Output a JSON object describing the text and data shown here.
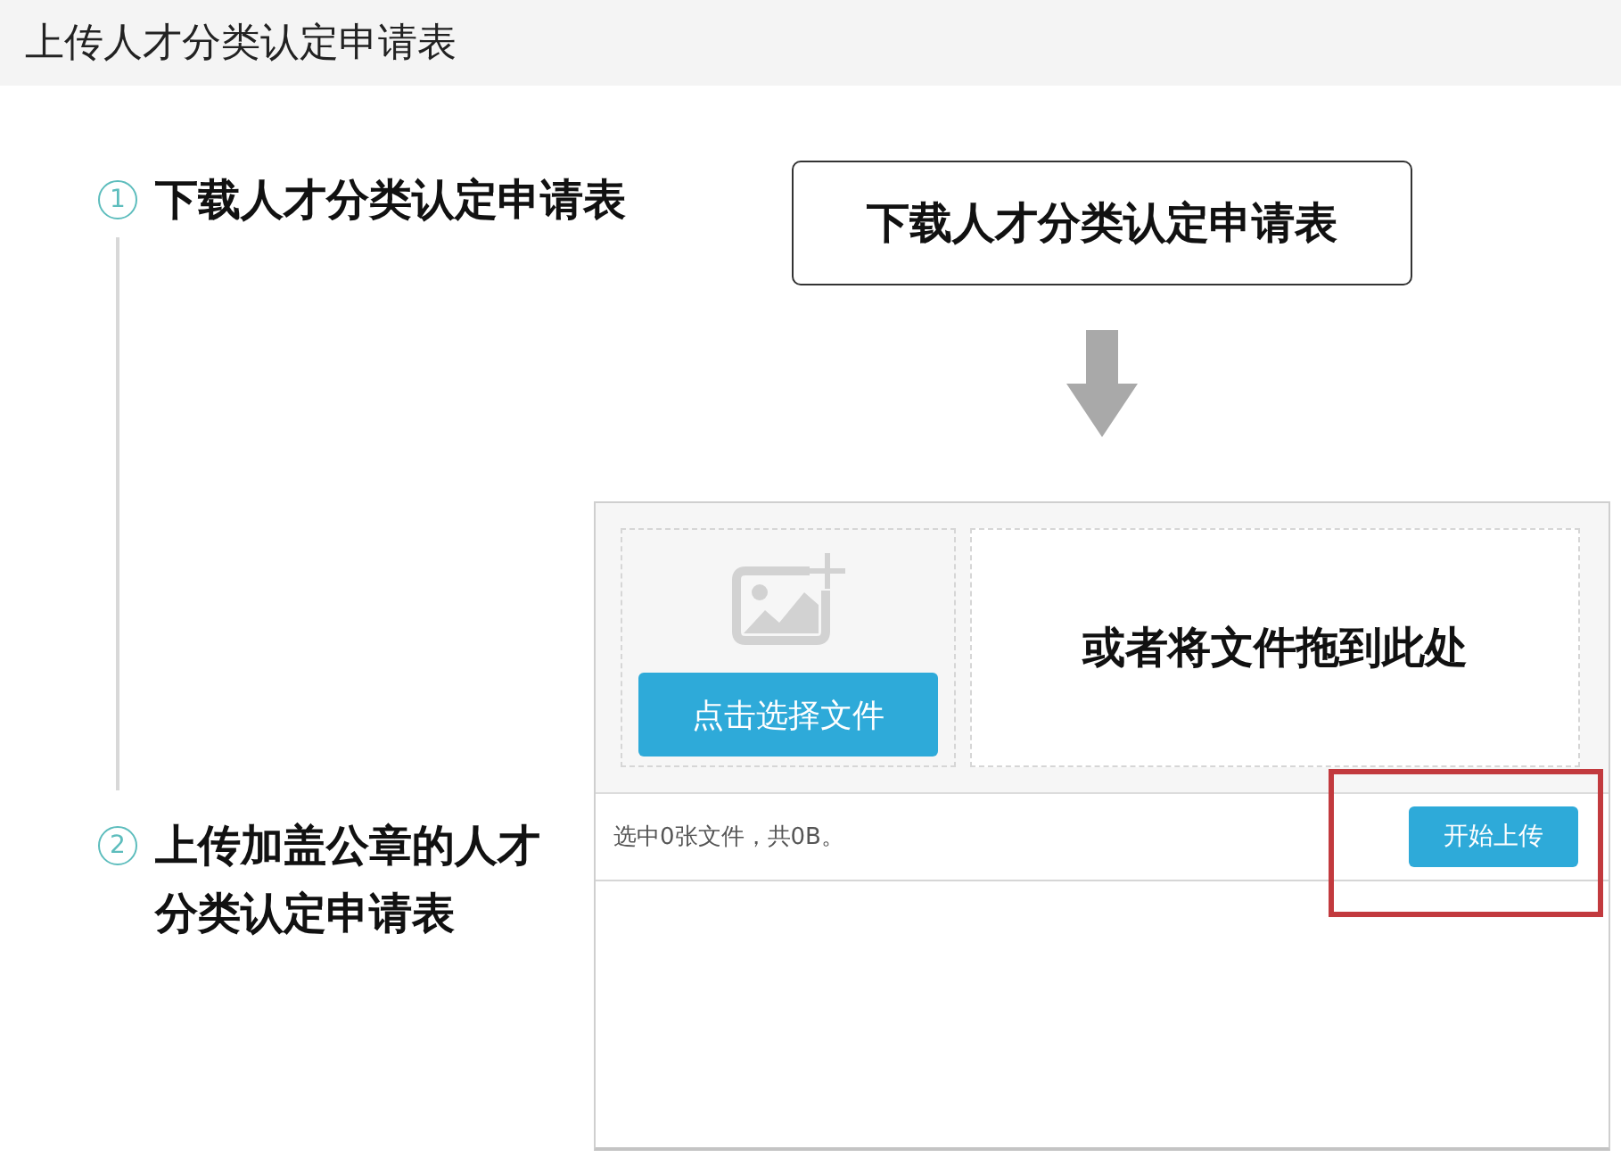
{
  "window": {
    "title": "上传人才分类认定申请表"
  },
  "steps": [
    {
      "number": "1",
      "label": "下载人才分类认定申请表"
    },
    {
      "number": "2",
      "label": "上传加盖公章的人才分类认定申请表"
    }
  ],
  "download_button": {
    "label": "下载人才分类认定申请表"
  },
  "uploader": {
    "choose_button": "点击选择文件",
    "drop_hint": "或者将文件拖到此处",
    "status": "选中0张文件，共0B。",
    "upload_button": "开始上传",
    "highlighted": true
  }
}
